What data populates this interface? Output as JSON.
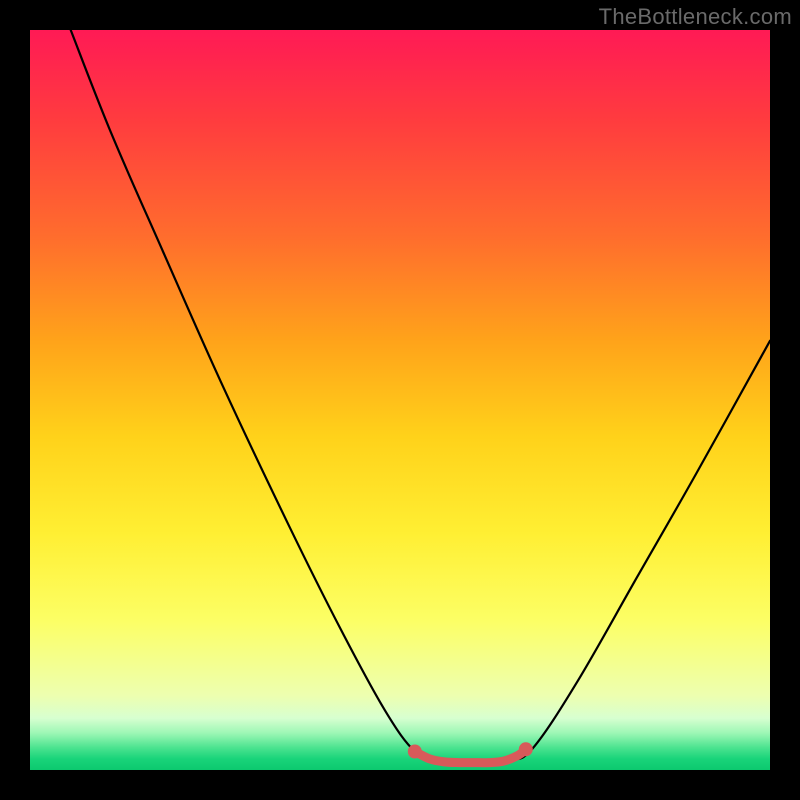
{
  "watermark": "TheBottleneck.com",
  "chart_data": {
    "type": "line",
    "title": "",
    "xlabel": "",
    "ylabel": "",
    "x_range": [
      0,
      100
    ],
    "y_range": [
      0,
      100
    ],
    "series": [
      {
        "name": "main-curve",
        "points": [
          {
            "x": 5.5,
            "y": 100
          },
          {
            "x": 11,
            "y": 86
          },
          {
            "x": 18,
            "y": 70
          },
          {
            "x": 26,
            "y": 52
          },
          {
            "x": 35,
            "y": 33
          },
          {
            "x": 42,
            "y": 19
          },
          {
            "x": 48,
            "y": 8
          },
          {
            "x": 52,
            "y": 2.5
          },
          {
            "x": 55,
            "y": 1.2
          },
          {
            "x": 58,
            "y": 1.0
          },
          {
            "x": 62,
            "y": 1.0
          },
          {
            "x": 65,
            "y": 1.3
          },
          {
            "x": 68,
            "y": 3
          },
          {
            "x": 74,
            "y": 12
          },
          {
            "x": 82,
            "y": 26
          },
          {
            "x": 90,
            "y": 40
          },
          {
            "x": 100,
            "y": 58
          }
        ]
      },
      {
        "name": "highlight-segment",
        "points": [
          {
            "x": 52,
            "y": 2.5
          },
          {
            "x": 54,
            "y": 1.5
          },
          {
            "x": 56,
            "y": 1.1
          },
          {
            "x": 58,
            "y": 1.0
          },
          {
            "x": 60,
            "y": 1.0
          },
          {
            "x": 62,
            "y": 1.0
          },
          {
            "x": 64,
            "y": 1.2
          },
          {
            "x": 66,
            "y": 2.0
          },
          {
            "x": 67,
            "y": 2.8
          }
        ]
      }
    ],
    "colors": {
      "curve": "#000000",
      "highlight": "#d85a5a",
      "gradient_top": "#ff1a55",
      "gradient_bottom": "#0cc96f",
      "frame": "#000000"
    }
  }
}
